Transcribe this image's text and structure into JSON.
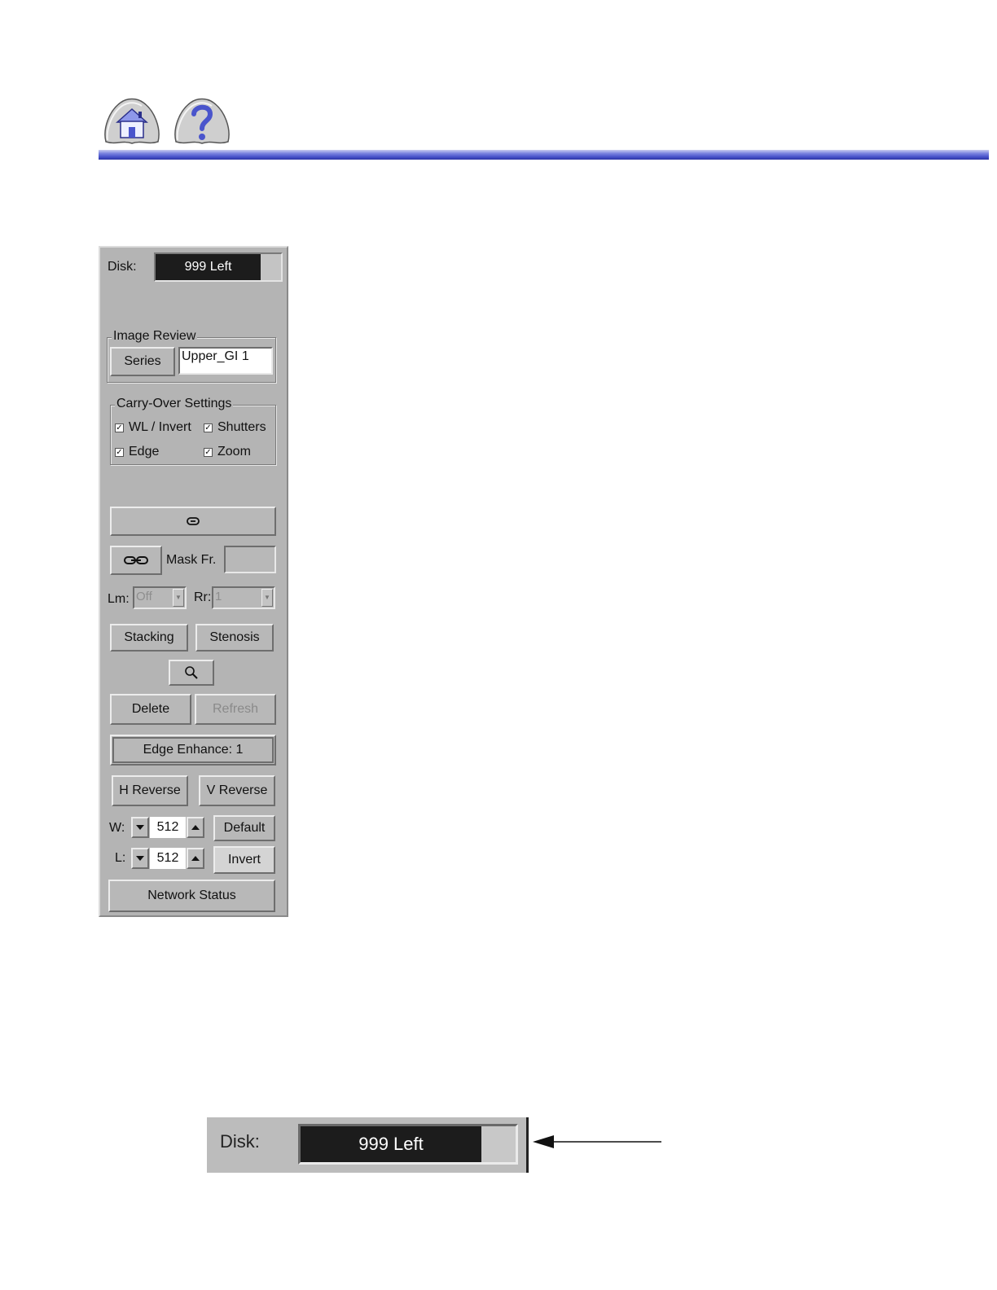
{
  "header": {
    "home_icon": "home-icon",
    "help_icon": "help-question-icon",
    "rule_color": "#4a55cc"
  },
  "panel": {
    "disk": {
      "label": "Disk:",
      "value": "999 Left",
      "fill_fraction": 0.84
    },
    "image_review": {
      "title": "Image Review",
      "series_button": "Series",
      "series_value": "Upper_GI 1"
    },
    "carry_over": {
      "title": "Carry-Over Settings",
      "items": [
        {
          "label": "WL / Invert",
          "checked": true
        },
        {
          "label": "Shutters",
          "checked": true
        },
        {
          "label": "Edge",
          "checked": true
        },
        {
          "label": "Zoom",
          "checked": true
        }
      ]
    },
    "link_button_icon": "link-icon",
    "unlink_button_icon": "unlink-icon",
    "mask": {
      "label": "Mask Fr.",
      "value": ""
    },
    "lm": {
      "label": "Lm:",
      "value": "Off"
    },
    "rr": {
      "label": "Rr:",
      "value": "1"
    },
    "stacking_button": "Stacking",
    "stenosis_button": "Stenosis",
    "magnify_icon": "magnifier-icon",
    "delete_button": "Delete",
    "refresh_button": "Refresh",
    "edge_enhance_button": "Edge Enhance:  1",
    "h_reverse_button": "H Reverse",
    "v_reverse_button": "V Reverse",
    "window": {
      "label": "W:",
      "value": "512"
    },
    "level": {
      "label": "L:",
      "value": "512"
    },
    "default_button": "Default",
    "invert_button": "Invert",
    "network_status_button": "Network Status"
  },
  "callout": {
    "label": "Disk:",
    "value": "999 Left",
    "fill_fraction": 0.84
  }
}
